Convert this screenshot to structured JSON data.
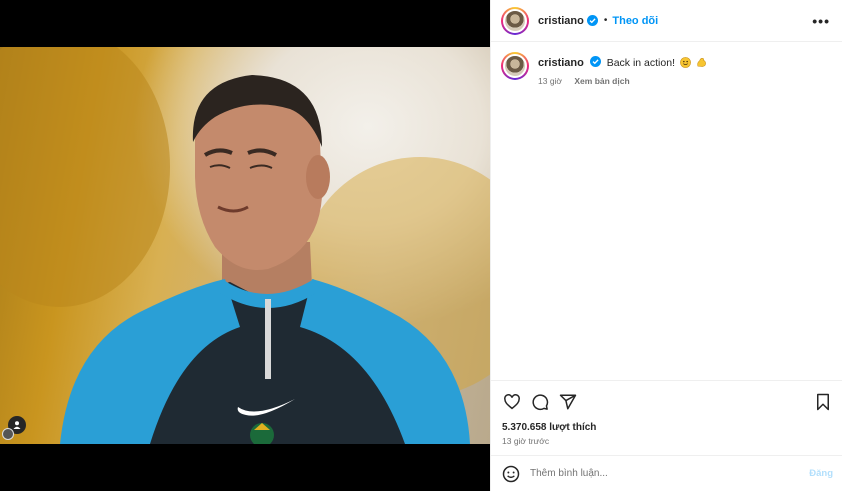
{
  "header": {
    "username": "cristiano",
    "separator": "•",
    "follow_label": "Theo dõi",
    "more_label": "•••"
  },
  "caption": {
    "username": "cristiano",
    "text": "Back in action!",
    "emojis": [
      "smiling-face-emoji",
      "flexed-biceps-emoji"
    ],
    "time": "13 giờ",
    "see_translation": "Xem bản dịch"
  },
  "actions": {
    "icons": [
      "heart-icon",
      "comment-icon",
      "share-icon",
      "bookmark-icon"
    ],
    "likes": "5.370.658 lượt thích",
    "time_ago": "13 giờ trước"
  },
  "comment": {
    "placeholder": "Thêm bình luận...",
    "post_label": "Đăng"
  },
  "colors": {
    "accent": "#0095f6",
    "verified": "#0095f6",
    "muted_text": "#737373",
    "post_disabled": "#b2dffc"
  }
}
